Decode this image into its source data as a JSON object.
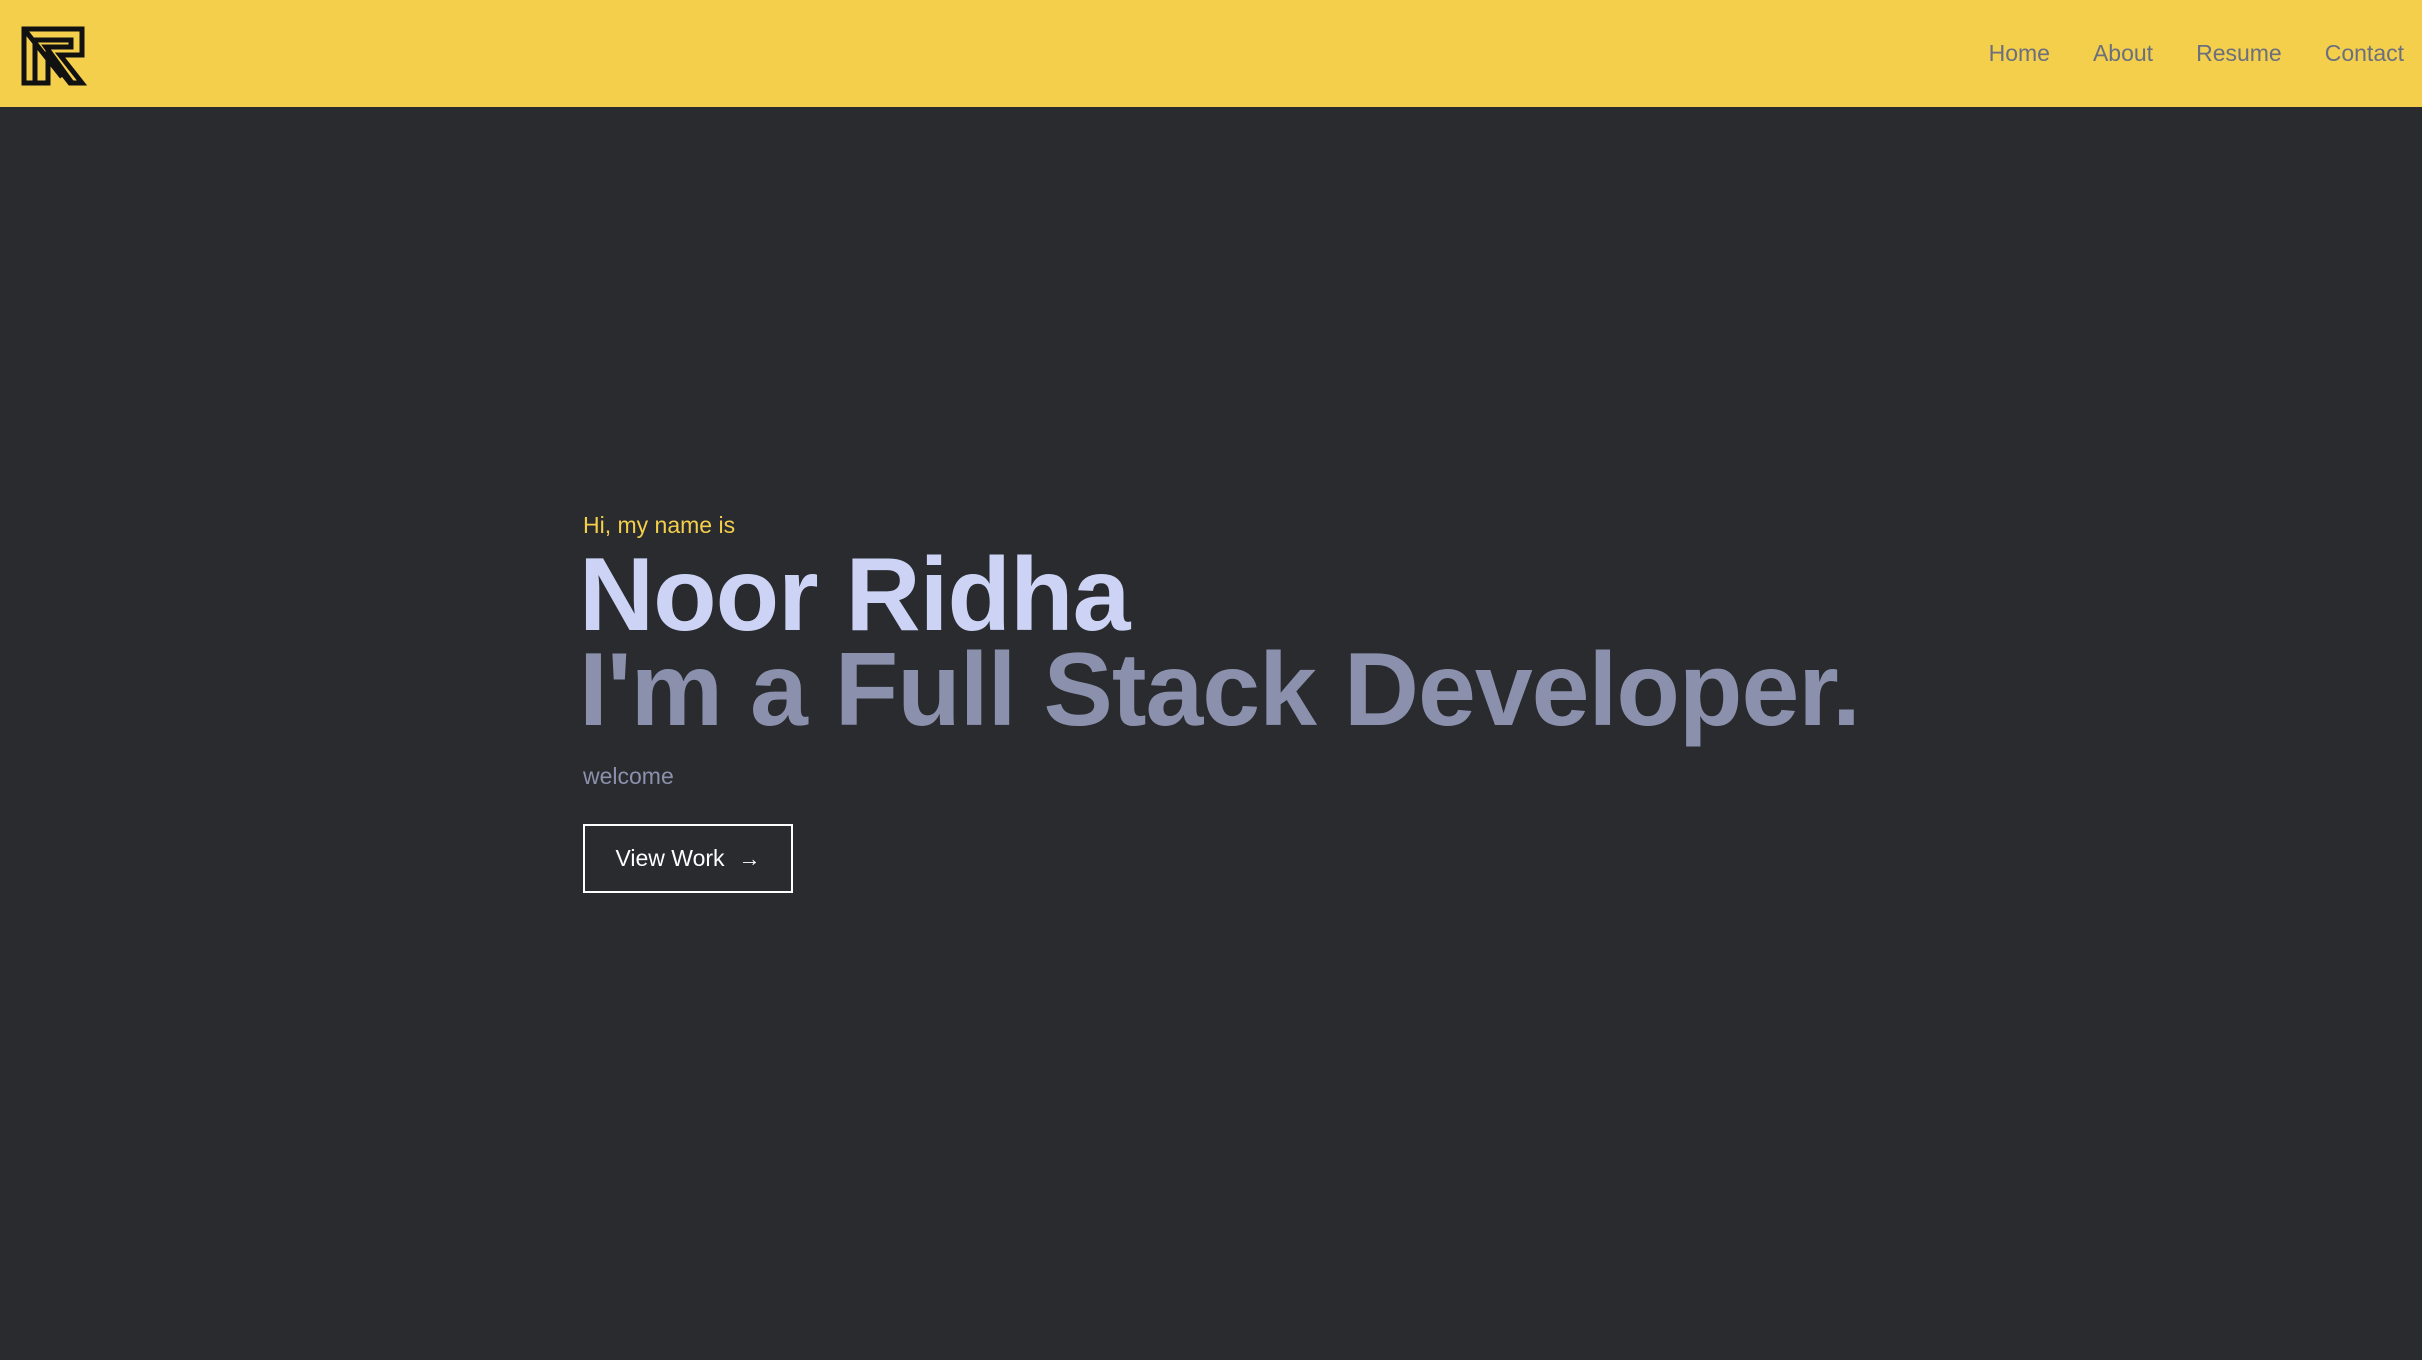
{
  "nav": {
    "logo_icon": "nr-monogram-logo-icon",
    "links": [
      "Home",
      "About",
      "Resume",
      "Contact"
    ]
  },
  "hero": {
    "greeting": "Hi, my name is",
    "name": "Noor Ridha",
    "tagline": "I'm a Full Stack Developer.",
    "subtitle": "welcome",
    "cta_label": "View Work",
    "cta_icon": "arrow-right-icon"
  },
  "colors": {
    "navbar_bg": "#f3cf4c",
    "page_bg": "#2a2b2f",
    "accent": "#f3cf4c",
    "name": "#ccd3f5",
    "tagline": "#8b91ad"
  }
}
